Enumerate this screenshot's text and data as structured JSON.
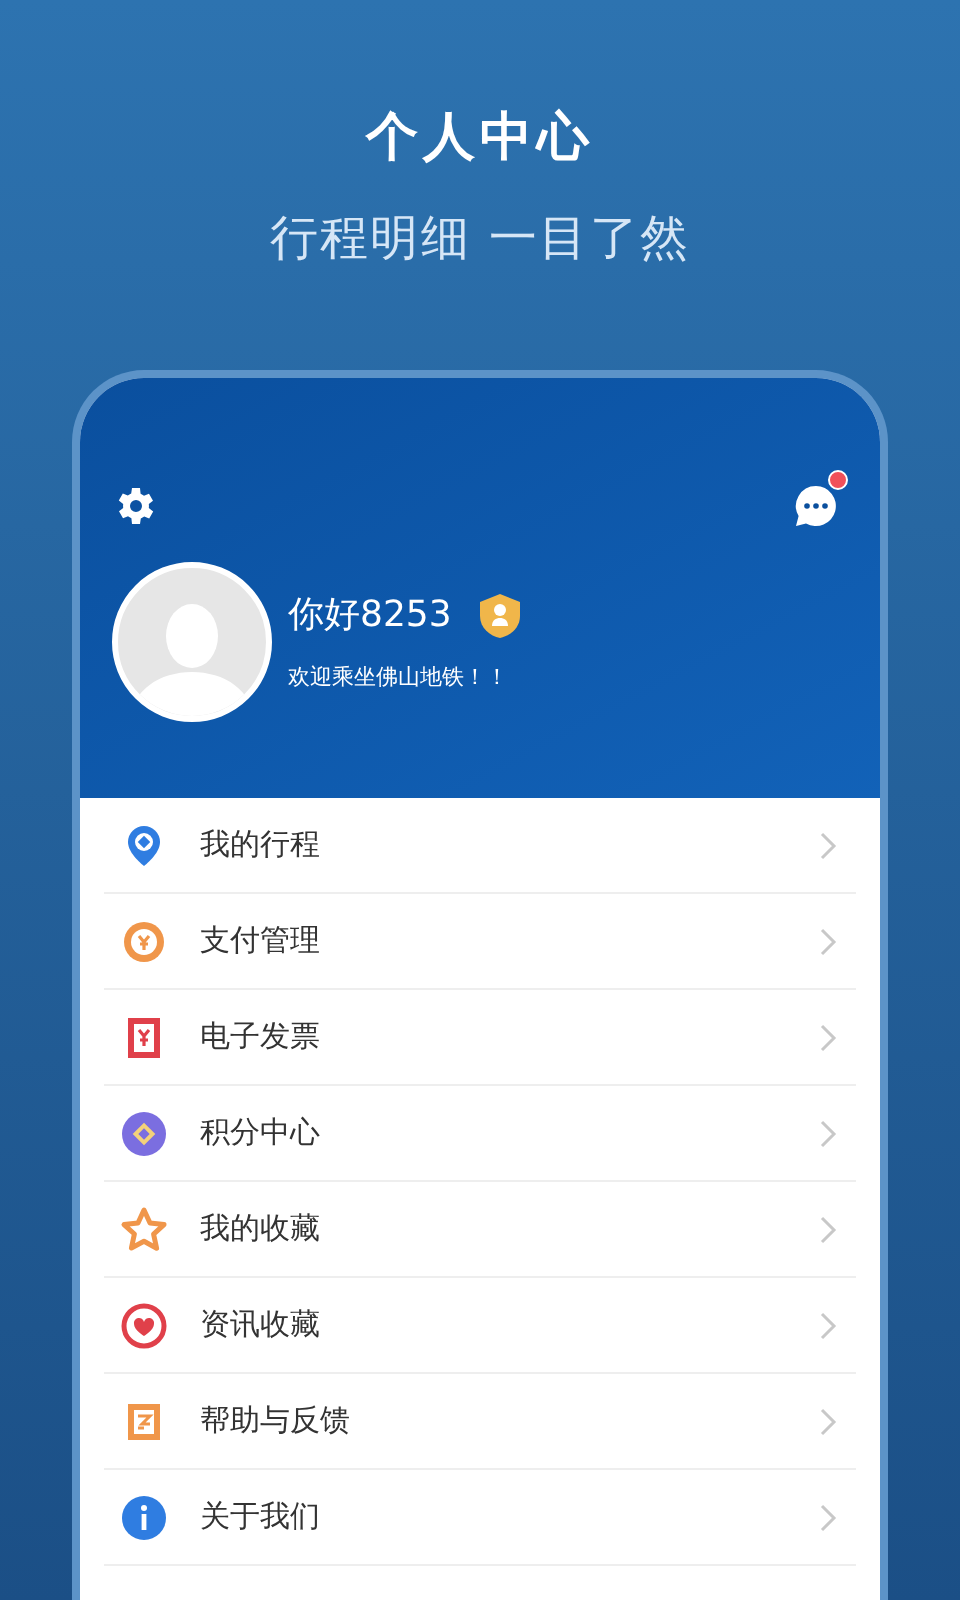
{
  "promo": {
    "title": "个人中心",
    "subtitle": "行程明细 一目了然"
  },
  "header": {
    "has_unread_messages": true,
    "greeting": "你好8253",
    "welcome": "欢迎乘坐佛山地铁！！",
    "verified": true
  },
  "menu": [
    {
      "label": "我的行程"
    },
    {
      "label": "支付管理"
    },
    {
      "label": "电子发票"
    },
    {
      "label": "积分中心"
    },
    {
      "label": "我的收藏"
    },
    {
      "label": "资讯收藏"
    },
    {
      "label": "帮助与反馈"
    },
    {
      "label": "关于我们"
    }
  ]
}
